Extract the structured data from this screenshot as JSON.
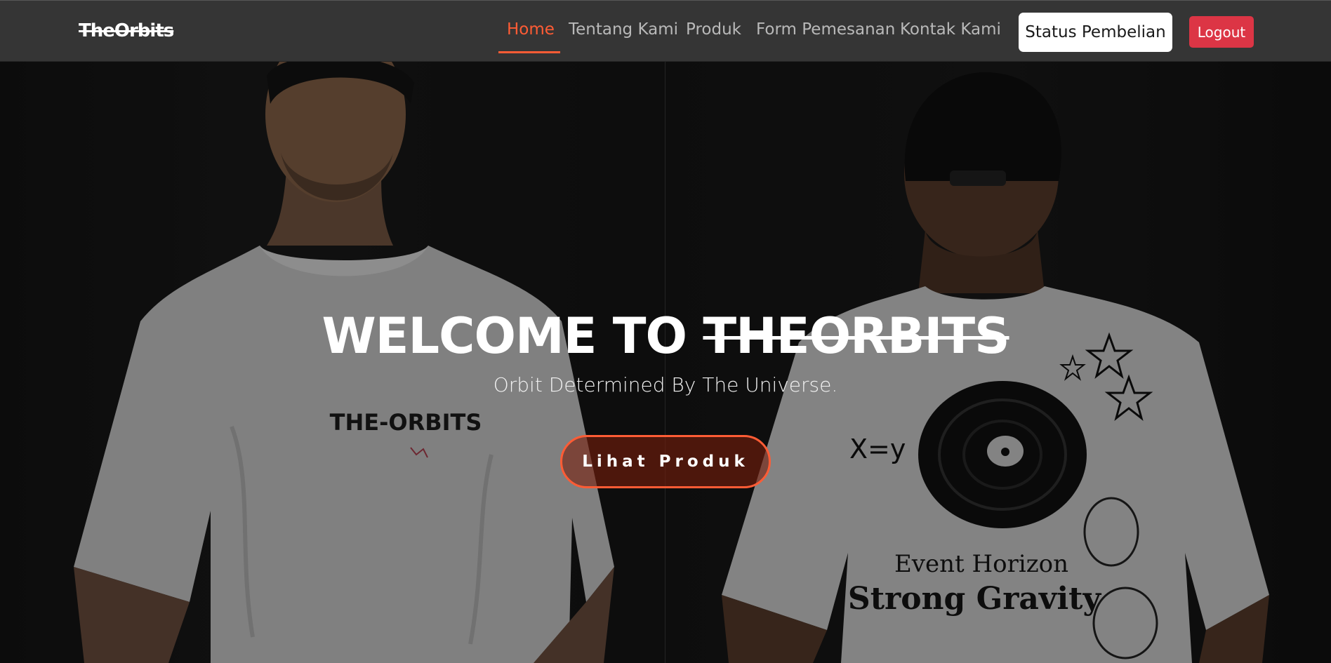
{
  "brand": {
    "logo_text": "TheOrbits"
  },
  "nav": {
    "items": [
      {
        "label": "Home",
        "active": true
      },
      {
        "label": "Tentang Kami",
        "active": false
      },
      {
        "label": "Produk",
        "active": false
      },
      {
        "label": "Form Pemesanan",
        "active": false
      },
      {
        "label": "Kontak Kami",
        "active": false
      }
    ],
    "status_button_label": "Status Pembelian",
    "logout_button_label": "Logout"
  },
  "hero": {
    "title_prefix": "WELCOME TO ",
    "title_brand": "THEORBITS",
    "subtitle": "Orbit Determined By The Universe.",
    "cta_label": "Lihat Produk",
    "left_shirt_print": "THE-ORBITS",
    "right_shirt_print_line1": "Event Horizon",
    "right_shirt_print_line2": "Strong Gravity",
    "right_shirt_formula": "X=y"
  },
  "colors": {
    "navbar_bg": "#353535",
    "accent": "#ff5c35",
    "logout_bg": "#dc3545",
    "status_bg": "#ffffff",
    "nav_text": "#b9b9b9"
  }
}
